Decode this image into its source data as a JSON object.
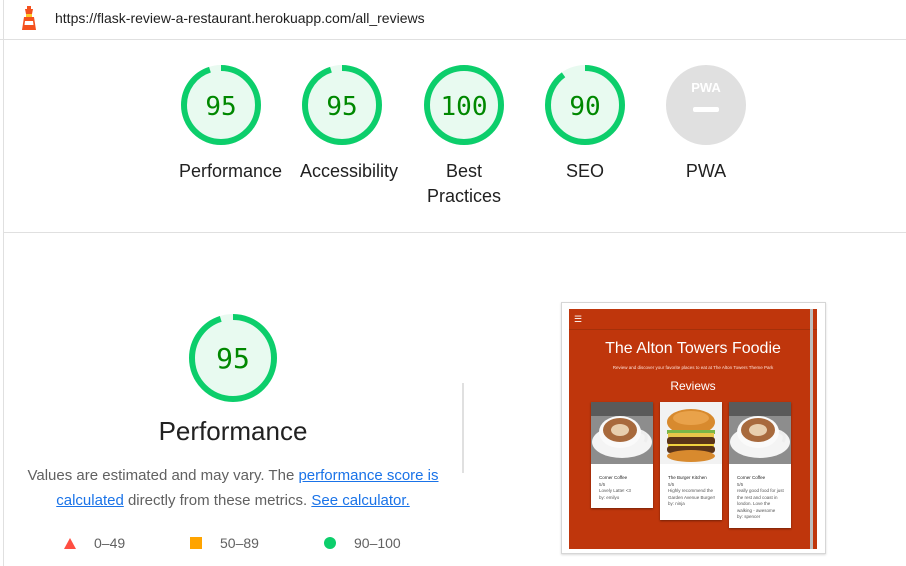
{
  "url": "https://flask-review-a-restaurant.herokuapp.com/all_reviews",
  "colors": {
    "pass": "#0cce6b",
    "pass_fill": "#e8faf0",
    "pass_text": "#008800",
    "average": "#ffa400",
    "fail": "#ff4e42",
    "na": "#e0e0e0",
    "link": "#1a73e8",
    "screenshot_bg": "#bf360c"
  },
  "gauges": [
    {
      "score": "95",
      "label": "Performance",
      "fraction": 0.95
    },
    {
      "score": "95",
      "label": "Accessibility",
      "fraction": 0.95
    },
    {
      "score": "100",
      "label": "Best Practices",
      "fraction": 1.0
    },
    {
      "score": "90",
      "label": "SEO",
      "fraction": 0.9
    },
    {
      "score": "PWA",
      "label": "PWA",
      "fraction": 0
    }
  ],
  "performance": {
    "score": "95",
    "fraction": 0.95,
    "title": "Performance",
    "desc_part1": "Values are estimated and may vary. The ",
    "desc_link1": "performance score is calculated",
    "desc_part2": " directly from these metrics. ",
    "desc_link2": "See calculator.",
    "legend": {
      "fail": "0–49",
      "average": "50–89",
      "pass": "90–100"
    }
  },
  "screenshot": {
    "menu_icon": "hamburger-icon",
    "title": "The Alton Towers Foodie",
    "subtitle": "Review and discover your favorite places to eat at The Alton Towers Theme Park",
    "reviews_heading": "Reviews",
    "cards": [
      {
        "name": "Corner Coffee",
        "rating": "5/5",
        "text": "Lovely Latte! <3",
        "by": "by: emilyo"
      },
      {
        "name": "The Burger Kitchen",
        "rating": "5/5",
        "text": "Highly recommend the Garden Avenue Burger!",
        "by": "by: ninja"
      },
      {
        "name": "Corner Coffee",
        "rating": "5/5",
        "text": "really good food for just the rest and coast in london. Love the walking - awesome",
        "by": "by: spencer"
      }
    ]
  }
}
